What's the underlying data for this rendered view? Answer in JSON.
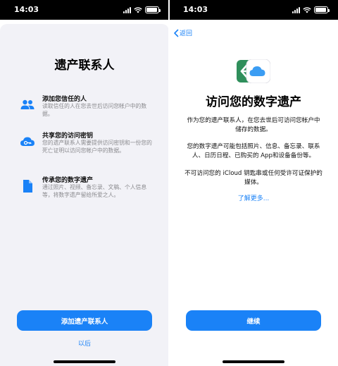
{
  "left_screen": {
    "status": {
      "time": "14:03"
    },
    "title": "遗产联系人",
    "features": [
      {
        "title": "添加您信任的人",
        "desc": "读取信任的人在您去世后访问您帐户中的数据。"
      },
      {
        "title": "共享您的访问密钥",
        "desc": "您的遗产联系人需要提供访问密钥和一份您的死亡证明以访问您帐户中的数据。"
      },
      {
        "title": "传承您的数字遗产",
        "desc": "通过照片、视频、备忘录、文稿、个人信息等，将数字遗产留给所爱之人。"
      }
    ],
    "primary_button": "添加遗产联系人",
    "secondary_link": "以后"
  },
  "right_screen": {
    "status": {
      "time": "14:03"
    },
    "back_label": "返回",
    "title": "访问您的数字遗产",
    "paragraph1": "作为您的遗产联系人，在您去世后可访问您帐户中储存的数据。",
    "paragraph2": "您的数字遗产可能包括照片、信息、备忘录、联系人、日历日程、已购买的 App和设备备份等。",
    "paragraph3": "不可访问您的 iCloud 钥匙串或任何受许可证保护的媒体。",
    "learn_more": "了解更多...",
    "primary_button": "继续"
  },
  "colors": {
    "accent": "#1a82f7",
    "sheet_bg": "#f2f2f7",
    "status_bar": "#000000",
    "app_icon_green": "#2f8f5b"
  }
}
